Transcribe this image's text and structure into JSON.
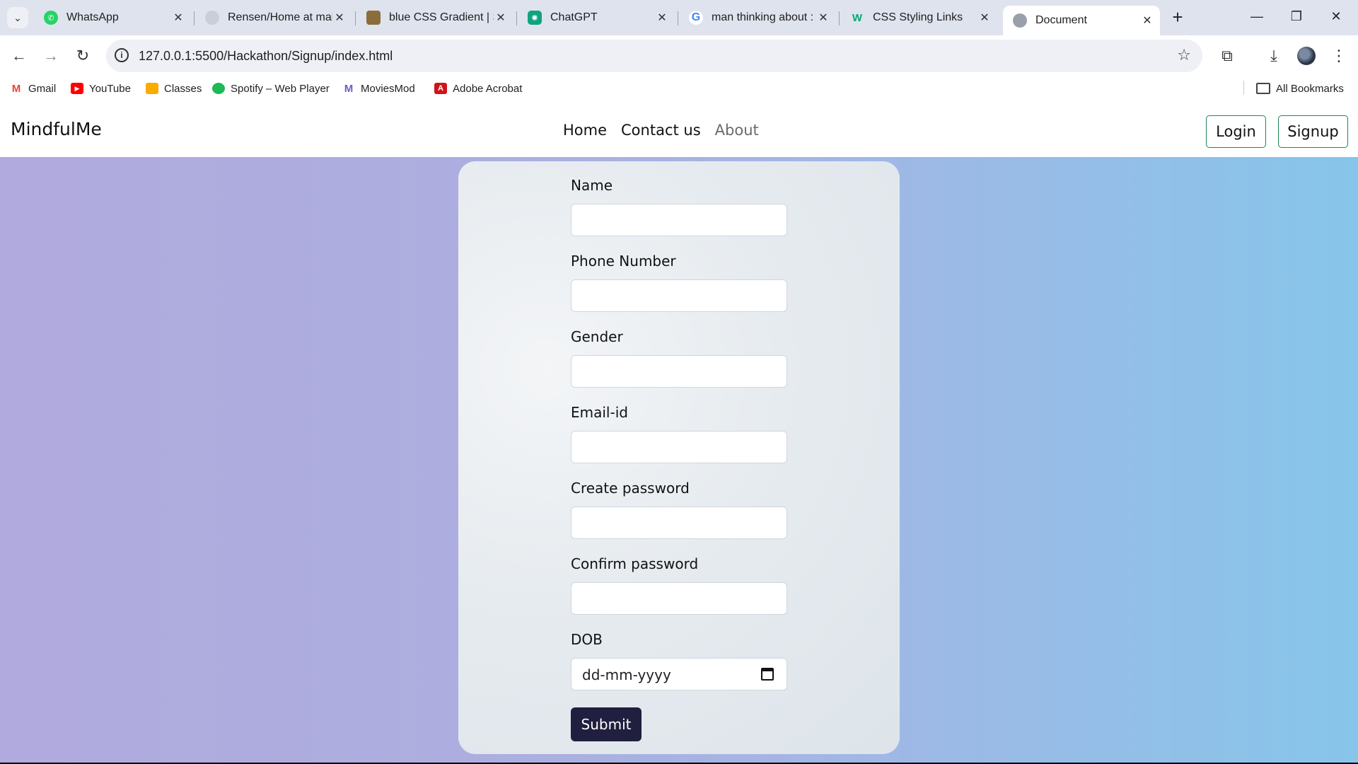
{
  "browser": {
    "tabs": [
      {
        "title": "WhatsApp",
        "icon": "whatsapp-icon",
        "color": "#25d366"
      },
      {
        "title": "Rensen/Home at mai",
        "icon": "github-icon",
        "color": "#d0d4dc"
      },
      {
        "title": "blue CSS Gradient | S",
        "icon": "site-icon",
        "color": "#8a6d3b"
      },
      {
        "title": "ChatGPT",
        "icon": "chatgpt-icon",
        "color": "#10a37f"
      },
      {
        "title": "man thinking about :",
        "icon": "google-icon",
        "color": "#4285f4"
      },
      {
        "title": "CSS Styling Links",
        "icon": "w3schools-icon",
        "color": "#04aa6d"
      },
      {
        "title": "Document",
        "icon": "globe-icon",
        "color": "#9aa0ab"
      }
    ],
    "url": "127.0.0.1:5500/Hackathon/Signup/index.html",
    "bookmarks": [
      {
        "label": "Gmail",
        "icon": "gmail-icon",
        "color": "#ea4335"
      },
      {
        "label": "YouTube",
        "icon": "youtube-icon",
        "color": "#ff0000"
      },
      {
        "label": "Classes",
        "icon": "classroom-icon",
        "color": "#f9ab00"
      },
      {
        "label": "Spotify – Web Player",
        "icon": "spotify-icon",
        "color": "#1db954"
      },
      {
        "label": "MoviesMod",
        "icon": "moviesmod-icon",
        "color": "#6a5acd"
      },
      {
        "label": "Adobe Acrobat",
        "icon": "acrobat-icon",
        "color": "#d0131b"
      }
    ],
    "all_bookmarks": "All Bookmarks"
  },
  "site": {
    "brand": "MindfulMe",
    "nav": {
      "home": "Home",
      "contact": "Contact us",
      "about": "About"
    },
    "login": "Login",
    "signup": "Signup",
    "accent": "#198754"
  },
  "form": {
    "name_label": "Name",
    "phone_label": "Phone Number",
    "gender_label": "Gender",
    "email_label": "Email-id",
    "create_password_label": "Create password",
    "confirm_password_label": "Confirm password",
    "dob_label": "DOB",
    "dob_placeholder": "dd-mm-yyyy",
    "submit": "Submit"
  }
}
